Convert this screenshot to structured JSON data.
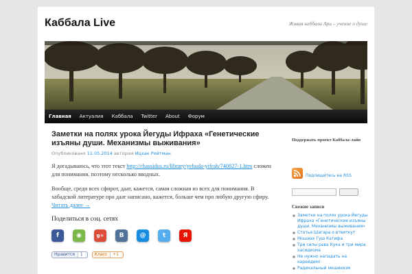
{
  "site": {
    "title": "Каббала Live",
    "description": "Живая каббала Ари – учение о душе"
  },
  "nav": {
    "items": [
      "Главная",
      "Актуалия",
      "Каббала",
      "Twitter",
      "About",
      "Форум"
    ]
  },
  "post": {
    "title": "Заметки на полях урока Йегуды Ифраха «Генетические изъяны души. Механизмы выживания»",
    "meta_prefix": "Опубликовано",
    "date": "11.05.2014",
    "meta_by": "автором",
    "author": "Ицхак Ройтман",
    "p1_start": "Я догадываюсь, что этот текст ",
    "p1_link": "http://chassidus.ru/library/yehuda-yifrah/740827-1.htm",
    "p1_end": " сложен для понимания. поэтому несколько вводных.",
    "p2": "Вообще, среди всех сфирот, даат, кажется, самая сложная из всех для понимания. В хабадской литературе про даат написано, кажется, больше чем про любую другую сфиру.",
    "read_more": "Читать далее →"
  },
  "share": {
    "heading": "Поделиться в соц. сетях",
    "buttons": [
      {
        "glyph": "f",
        "color": "#3b5998",
        "icon": "facebook-icon"
      },
      {
        "glyph": "◉",
        "color": "#7ab848",
        "icon": "livejournal-icon"
      },
      {
        "glyph": "g+",
        "color": "#dd4b39",
        "icon": "google-plus-icon"
      },
      {
        "glyph": "В",
        "color": "#507299",
        "icon": "vkontakte-icon"
      },
      {
        "glyph": "@",
        "color": "#168de2",
        "icon": "mail-icon"
      },
      {
        "glyph": "t",
        "color": "#55acee",
        "icon": "twitter-icon"
      },
      {
        "glyph": "Я",
        "color": "#e61400",
        "icon": "yandex-icon"
      }
    ],
    "counters": [
      {
        "label": "Нравится",
        "count": "1"
      },
      {
        "label": "Класс",
        "count": "+1"
      }
    ]
  },
  "sidebar": {
    "support_title": "Поддержать проект Каббала-лайв",
    "rss_label": "Подпишитесь на RSS",
    "recent_title": "Свежие записи",
    "recent": [
      "Заметки на полях урока Йегуды Ифраха «Генетические изъяны души. Механизмы выживания»",
      "Статья Шагара о втвиткут",
      "Мошиах Гуш Катифа",
      "Три силы рава Кука и три мира хасидизма",
      "Не нужно нападать на харейдим!",
      "Радикальный мешихизм"
    ]
  }
}
